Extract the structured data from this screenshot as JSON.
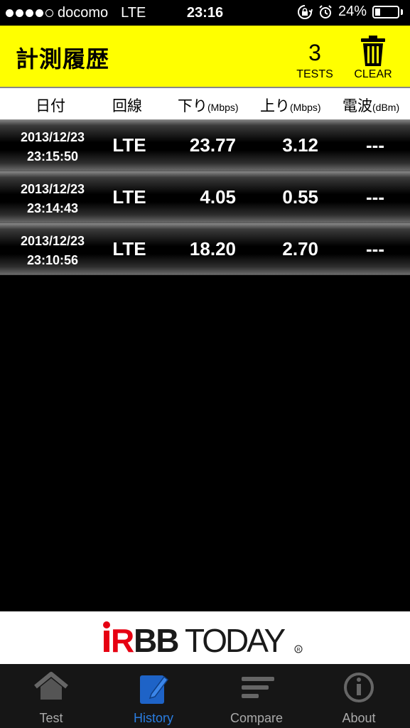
{
  "status_bar": {
    "carrier": "docomo",
    "network": "LTE",
    "time": "23:16",
    "battery": "24%",
    "battery_level": 0.24
  },
  "header": {
    "title": "計測履歴",
    "tests_count": "3",
    "tests_label": "TESTS",
    "clear_label": "CLEAR"
  },
  "columns": {
    "date": "日付",
    "line": "回線",
    "down": "下り",
    "down_unit": "(Mbps)",
    "up": "上り",
    "up_unit": "(Mbps)",
    "signal": "電波",
    "signal_unit": "(dBm)"
  },
  "rows": [
    {
      "date": "2013/12/23",
      "time": "23:15:50",
      "line": "LTE",
      "down": "23.77",
      "up": "3.12",
      "signal": "---"
    },
    {
      "date": "2013/12/23",
      "time": "23:14:43",
      "line": "LTE",
      "down": "4.05",
      "up": "0.55",
      "signal": "---"
    },
    {
      "date": "2013/12/23",
      "time": "23:10:56",
      "line": "LTE",
      "down": "18.20",
      "up": "2.70",
      "signal": "---"
    }
  ],
  "banner": {
    "logo_text": "RBBTODAY",
    "colors": {
      "red": "#e60012",
      "black": "#1a1a1a"
    }
  },
  "tabs": [
    {
      "label": "Test",
      "icon": "house-icon",
      "active": false
    },
    {
      "label": "History",
      "icon": "notepad-pencil-icon",
      "active": true
    },
    {
      "label": "Compare",
      "icon": "bars-icon",
      "active": false
    },
    {
      "label": "About",
      "icon": "info-icon",
      "active": false
    }
  ],
  "colors": {
    "header_bg": "#ffff00",
    "accent": "#2a7de1"
  }
}
